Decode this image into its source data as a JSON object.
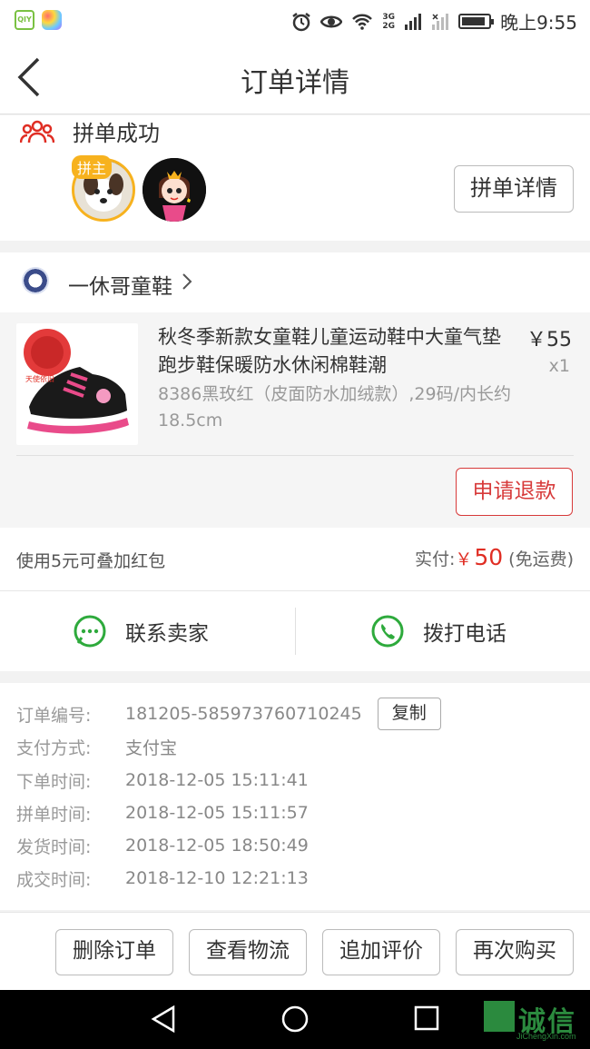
{
  "status_bar": {
    "time": "晚上9:55",
    "network": "3G\n2G",
    "battery_level": 0.9
  },
  "nav": {
    "title": "订单详情"
  },
  "group": {
    "status": "拼单成功",
    "leader_badge": "拼主",
    "detail_button": "拼单详情"
  },
  "shop": {
    "name": "一休哥童鞋"
  },
  "product": {
    "title": "秋冬季新款女童鞋儿童运动鞋中大童气垫跑步鞋保暖防水休闲棉鞋潮",
    "spec": "8386黑玫红（皮面防水加绒款）,29码/内长约18.5cm",
    "price": "￥55",
    "qty": "x1",
    "refund_button": "申请退款"
  },
  "payment": {
    "coupon": "使用5元可叠加红包",
    "paid_label": "实付:",
    "currency": "￥",
    "amount": "50",
    "shipping": "(免运费)"
  },
  "contact": {
    "seller": "联系卖家",
    "phone": "拨打电话"
  },
  "order_info": {
    "rows": [
      {
        "label": "订单编号:",
        "value": "181205-585973760710245"
      },
      {
        "label": "支付方式:",
        "value": "支付宝"
      },
      {
        "label": "下单时间:",
        "value": "2018-12-05 15:11:41"
      },
      {
        "label": "拼单时间:",
        "value": "2018-12-05 15:11:57"
      },
      {
        "label": "发货时间:",
        "value": "2018-12-05 18:50:49"
      },
      {
        "label": "成交时间:",
        "value": "2018-12-10 12:21:13"
      }
    ],
    "copy_button": "复制"
  },
  "actions": {
    "delete": "删除订单",
    "logistics": "查看物流",
    "review": "追加评价",
    "rebuy": "再次购买"
  },
  "watermark": {
    "text": "诚信",
    "sub": "JiChengXin.com"
  },
  "colors": {
    "accent": "#e02e24",
    "green": "#2eaa3c",
    "badge": "#f7b21e"
  }
}
